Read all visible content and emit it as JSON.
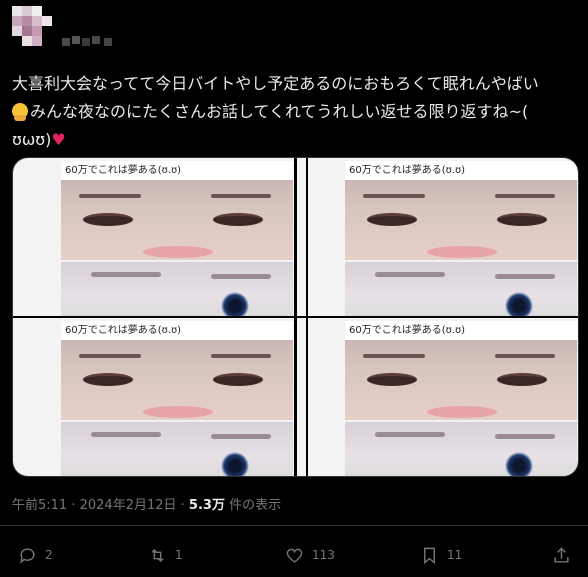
{
  "post": {
    "text_line1": "大喜利大会なってて今日バイトやし予定あるのにおもろくて眠れんやばい",
    "text_line2": "みんな夜なのにたくさんお話してくれてうれしい返せる限り返すね~(",
    "text_line3": "ʊωʊ",
    "text_line3_tail": ")",
    "heart": "♥",
    "emoji": "hugging-face-emoji"
  },
  "media": {
    "caption": "60万でこれは夢ある(ʊ.ʊ)"
  },
  "meta": {
    "time": "午前5:11",
    "dot": " · ",
    "date": "2024年2月12日",
    "dot2": " · ",
    "views": "5.3万",
    "views_label": " 件の表示"
  },
  "actions": {
    "reply_count": "2",
    "repost_count": "1",
    "like_count": "113",
    "bookmark_count": "11"
  },
  "colors": {
    "background": "#000000",
    "text": "#e7e9ea",
    "muted": "#71767b",
    "heart": "#e0245e"
  }
}
